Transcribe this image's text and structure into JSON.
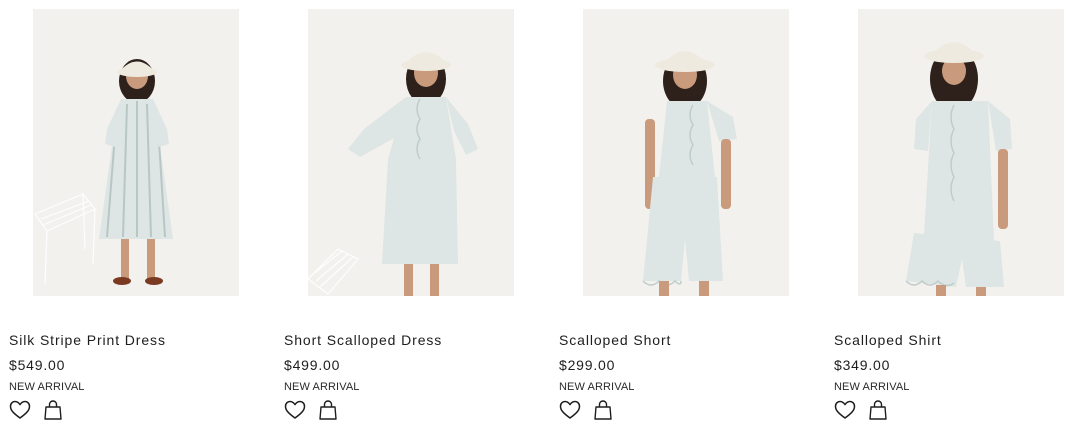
{
  "products": [
    {
      "name": "Silk Stripe Print Dress",
      "price": "$549.00",
      "badge": "NEW ARRIVAL",
      "image_alt": "Silk Stripe Print Dress",
      "wishlist_icon": "heart-icon",
      "bag_icon": "shopping-bag-icon"
    },
    {
      "name": "Short Scalloped Dress",
      "price": "$499.00",
      "badge": "NEW ARRIVAL",
      "image_alt": "Short Scalloped Dress",
      "wishlist_icon": "heart-icon",
      "bag_icon": "shopping-bag-icon"
    },
    {
      "name": "Scalloped Short",
      "price": "$299.00",
      "badge": "NEW ARRIVAL",
      "image_alt": "Scalloped Short",
      "wishlist_icon": "heart-icon",
      "bag_icon": "shopping-bag-icon"
    },
    {
      "name": "Scalloped Shirt",
      "price": "$349.00",
      "badge": "NEW ARRIVAL",
      "image_alt": "Scalloped Shirt",
      "wishlist_icon": "heart-icon",
      "bag_icon": "shopping-bag-icon"
    }
  ],
  "colors": {
    "photo_background": "#f3f1ee",
    "garment": "#dde6e4",
    "hat": "#efeae0",
    "hair": "#2e211b",
    "skin": "#c99a7c",
    "text": "#1e1e1e"
  }
}
